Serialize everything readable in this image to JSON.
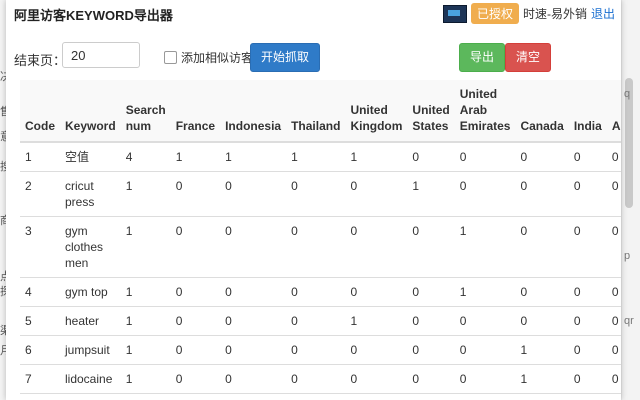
{
  "background": {
    "left_glyphs": [
      "决",
      "售",
      "意",
      "搜",
      "商",
      "点",
      "探",
      "渠",
      "月"
    ],
    "right_glyphs": [
      "q",
      "p",
      "qr"
    ]
  },
  "header": {
    "title": "阿里访客KEYWORD导出器",
    "badge": "已授权",
    "username": "时速-易外销",
    "logout": "退出"
  },
  "controls": {
    "end_page_label": "结束页：",
    "end_page_value": "20",
    "similar_visitors_label": "添加相似访客",
    "start_button": "开始抓取",
    "export_button": "导出",
    "clear_button": "清空"
  },
  "table": {
    "columns": [
      "Code",
      "Keyword",
      "Search num",
      "France",
      "Indonesia",
      "Thailand",
      "United Kingdom",
      "United States",
      "United Arab Emirates",
      "Canada",
      "India",
      "A"
    ],
    "rows": [
      [
        "1",
        "空值",
        "4",
        "1",
        "1",
        "1",
        "1",
        "0",
        "0",
        "0",
        "0",
        "0"
      ],
      [
        "2",
        "cricut press",
        "1",
        "0",
        "0",
        "0",
        "0",
        "1",
        "0",
        "0",
        "0",
        "0"
      ],
      [
        "3",
        "gym clothes men",
        "1",
        "0",
        "0",
        "0",
        "0",
        "0",
        "1",
        "0",
        "0",
        "0"
      ],
      [
        "4",
        "gym top",
        "1",
        "0",
        "0",
        "0",
        "0",
        "0",
        "1",
        "0",
        "0",
        "0"
      ],
      [
        "5",
        "heater",
        "1",
        "0",
        "0",
        "0",
        "1",
        "0",
        "0",
        "0",
        "0",
        "0"
      ],
      [
        "6",
        "jumpsuit",
        "1",
        "0",
        "0",
        "0",
        "0",
        "0",
        "0",
        "1",
        "0",
        "0"
      ],
      [
        "7",
        "lidocaine",
        "1",
        "0",
        "0",
        "0",
        "0",
        "0",
        "0",
        "1",
        "0",
        "0"
      ]
    ]
  },
  "colors": {
    "start": "#2f7bc8",
    "export": "#5cb85c",
    "clear": "#d9534f",
    "badge": "#f0ad4e",
    "link": "#1a6fd0"
  }
}
